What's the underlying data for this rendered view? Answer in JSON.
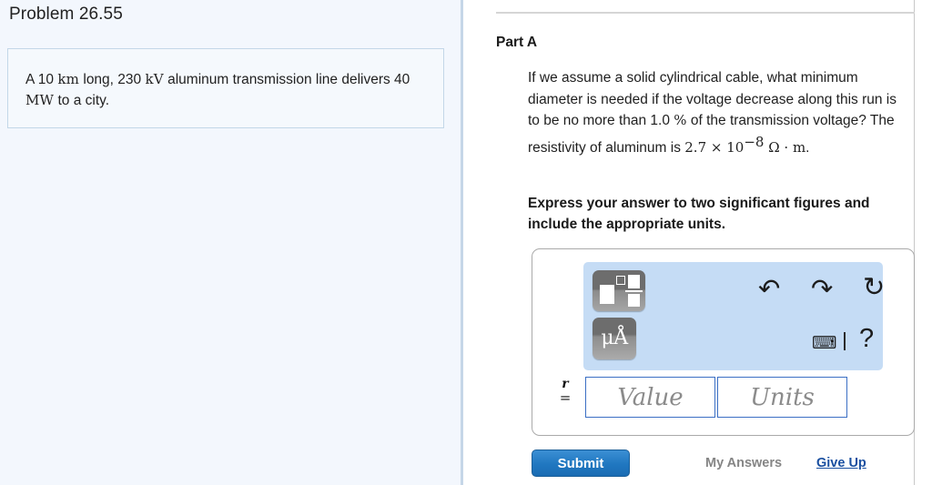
{
  "left": {
    "problem_title": "Problem 26.55",
    "statement": {
      "seg1": "A 10 ",
      "unit1": "km",
      "seg2": " long, 230 ",
      "unit2": "kV",
      "seg3": " aluminum transmission line delivers 40 ",
      "unit3": "MW",
      "seg4": " to a city."
    }
  },
  "right": {
    "part_label": "Part A",
    "question": {
      "seg1": "If we assume a solid cylindrical cable, what minimum diameter is needed if the voltage decrease along this run is to be no more than 1.0 ",
      "percent": "%",
      "seg2": " of the transmission voltage? The resistivity of aluminum is ",
      "resistivity_mantissa": "2.7 × 10",
      "resistivity_exponent": "−8",
      "resistivity_units": " Ω · m",
      "seg3": "."
    },
    "instruction": "Express your answer to two significant figures and include the appropriate units.",
    "toolbar": {
      "template_button_name": "math-template",
      "unit_button_label": "μÅ",
      "undo_glyph": "↶",
      "redo_glyph": "↷",
      "reset_glyph": "↻",
      "keyboard_glyph": "⌨",
      "help_glyph": "?"
    },
    "answer": {
      "variable_name": "r",
      "equals": "=",
      "value_placeholder": "Value",
      "value_current": "",
      "units_placeholder": "Units",
      "units_current": ""
    },
    "actions": {
      "submit_label": "Submit",
      "my_answers_label": "My Answers",
      "give_up_label": "Give Up"
    }
  },
  "colors": {
    "panel_background": "#f3f7fd",
    "toolbar_background": "#c5dcf5",
    "submit_blue": "#2077c0",
    "link_blue": "#1a4fa0",
    "input_border_blue": "#3b6fc4"
  }
}
